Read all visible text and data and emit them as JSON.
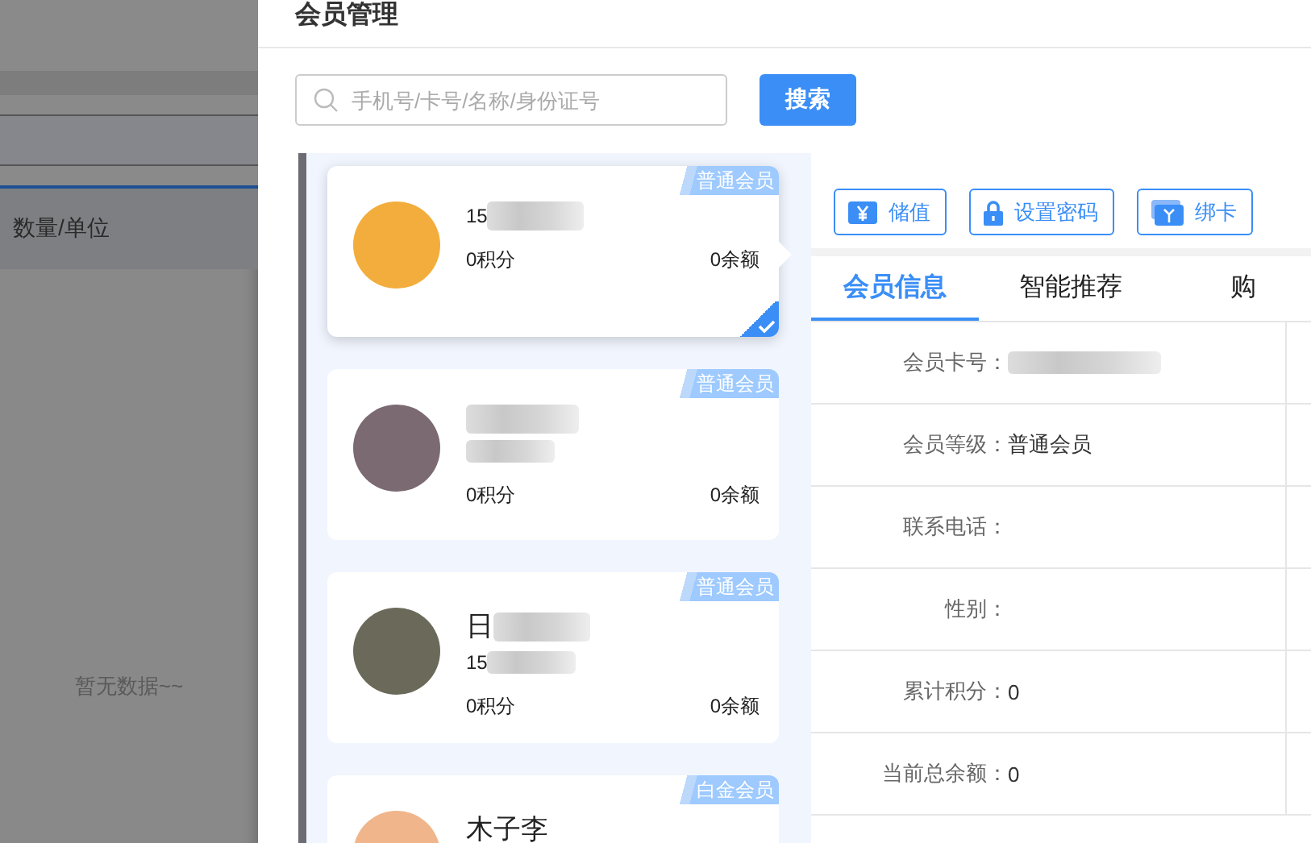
{
  "background_page": {
    "table_header": "数量/单位",
    "empty_text": "暂无数据~~"
  },
  "drawer": {
    "title": "会员管理",
    "search": {
      "placeholder": "手机号/卡号/名称/身份证号",
      "button": "搜索"
    },
    "members": [
      {
        "badge": "普通会员",
        "name": "15",
        "name_redacted": true,
        "points": "0积分",
        "balance": "0余额",
        "selected": true
      },
      {
        "badge": "普通会员",
        "name_redacted": true,
        "phone_redacted": true,
        "points": "0积分",
        "balance": "0余额",
        "selected": false
      },
      {
        "badge": "普通会员",
        "name": "日",
        "name_redacted": true,
        "phone": "15",
        "phone_redacted": true,
        "points": "0积分",
        "balance": "0余额",
        "selected": false
      },
      {
        "badge": "白金会员",
        "name": "木子李",
        "name_redacted": false,
        "selected": false
      }
    ],
    "actions": [
      {
        "label": "储值",
        "kind": "yuan"
      },
      {
        "label": "设置密码",
        "kind": "lock"
      },
      {
        "label": "绑卡",
        "kind": "card"
      }
    ],
    "tabs": [
      {
        "label": "会员信息",
        "selected": true
      },
      {
        "label": "智能推荐",
        "selected": false
      },
      {
        "label": "购",
        "selected": false
      }
    ],
    "info_rows": [
      {
        "label": "会员卡号：",
        "value_redacted": true
      },
      {
        "label": "会员等级：",
        "value": "普通会员"
      },
      {
        "label": "联系电话："
      },
      {
        "label": "性别："
      },
      {
        "label": "累计积分：",
        "value": "0"
      },
      {
        "label": "当前总余额：",
        "value": "0"
      }
    ]
  }
}
